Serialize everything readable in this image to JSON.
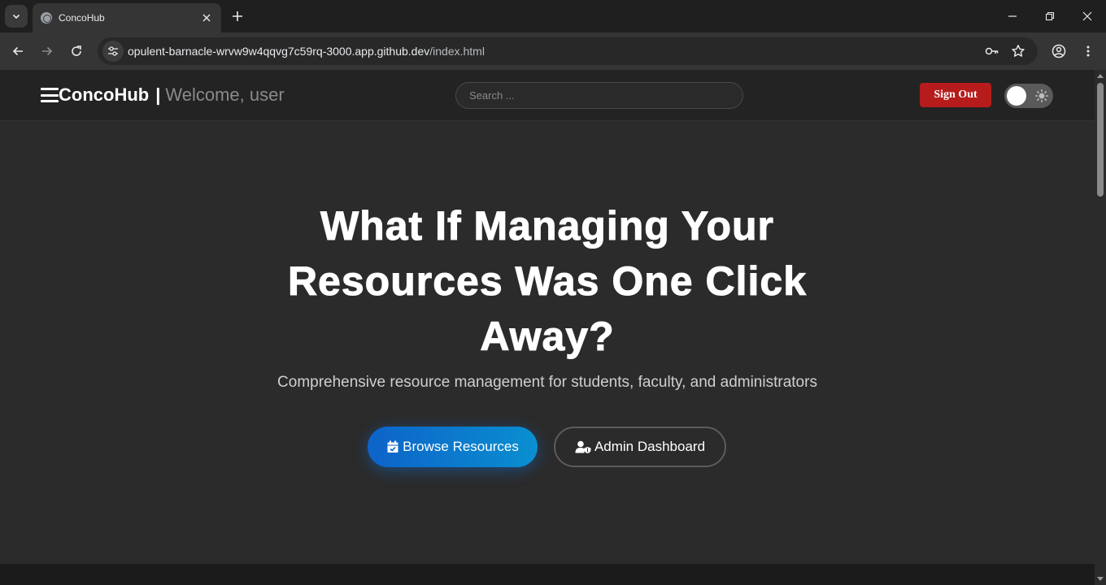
{
  "browser": {
    "tab_title": "ConcoHub",
    "url_host": "opulent-barnacle-wrvw9w4qqvg7c59rq-3000.app.github.dev",
    "url_path": "/index.html"
  },
  "header": {
    "brand": "ConcoHub",
    "separator": "|",
    "welcome": "Welcome, user",
    "search_placeholder": "Search ...",
    "signout_label": "Sign Out",
    "theme_toggle_state": "dark"
  },
  "hero": {
    "title": "What If Managing Your Resources Was One Click Away?",
    "subtitle": "Comprehensive resource management for students, faculty, and administrators",
    "browse_label": "Browse Resources",
    "admin_label": "Admin Dashboard"
  },
  "colors": {
    "signout": "#b71c1c",
    "browse_gradient_start": "#0d63c9",
    "browse_gradient_end": "#0a8fd0",
    "page_bg": "#2b2b2b"
  },
  "icons": {
    "tab_menu": "chevron-down-icon",
    "tab_close": "close-icon",
    "new_tab": "plus-icon",
    "back": "arrow-left-icon",
    "forward": "arrow-right-icon",
    "reload": "reload-icon",
    "site_info": "tune-icon",
    "password": "key-icon",
    "bookmark": "star-icon",
    "profile": "profile-icon",
    "menu": "kebab-menu-icon",
    "hamburger": "hamburger-icon",
    "theme": "sun-icon",
    "browse": "calendar-check-icon",
    "admin": "user-shield-icon"
  }
}
